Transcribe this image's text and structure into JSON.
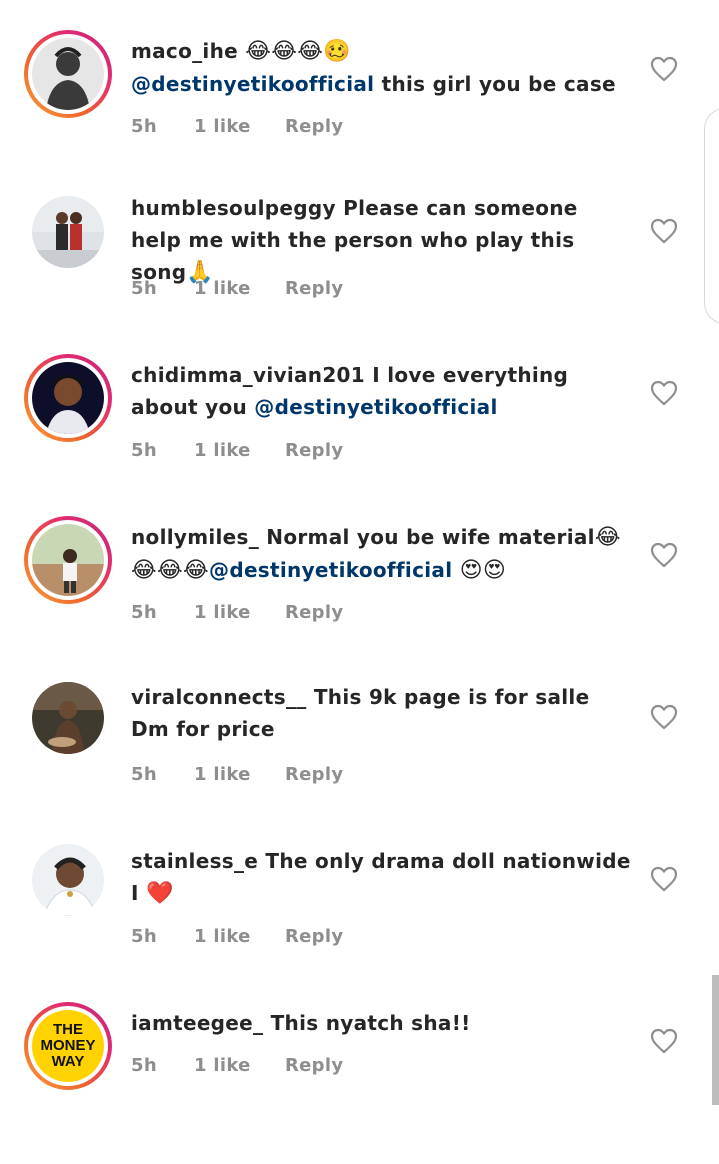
{
  "comments": [
    {
      "username": "maco_ihe",
      "parts": [
        {
          "t": " "
        },
        {
          "e": "😂😂😂🥴"
        },
        {
          "br": true
        },
        {
          "m": "@destinyetikoofficial"
        },
        {
          "t": " this girl you be case"
        }
      ],
      "time": "5h",
      "likes": "1 like",
      "reply": "Reply",
      "avatar": "silhouette-avatar",
      "story_ring": true
    },
    {
      "username": "humblesoulpeggy",
      "parts": [
        {
          "t": " Please can someone help me with the person who play this song"
        },
        {
          "e": "🙏"
        }
      ],
      "time": "5h",
      "likes": "1 like",
      "reply": "Reply",
      "avatar": "couple-photo-avatar",
      "story_ring": false
    },
    {
      "username": "chidimma_vivian201",
      "parts": [
        {
          "t": " I love everything about you "
        },
        {
          "m": "@destinyetikoofficial"
        }
      ],
      "time": "5h",
      "likes": "1 like",
      "reply": "Reply",
      "avatar": "woman-portrait-avatar",
      "story_ring": true
    },
    {
      "username": "nollymiles_",
      "parts": [
        {
          "t": " Normal you be wife material"
        },
        {
          "e": "😂😂😂😂"
        },
        {
          "m": "@destinyetikoofficial"
        },
        {
          "t": " "
        },
        {
          "e": "😍😍"
        }
      ],
      "time": "5h",
      "likes": "1 like",
      "reply": "Reply",
      "avatar": "man-outdoor-avatar",
      "story_ring": true
    },
    {
      "username": "viralconnects__",
      "parts": [
        {
          "t": " This 9k page is for salle Dm for price"
        }
      ],
      "time": "5h",
      "likes": "1 like",
      "reply": "Reply",
      "avatar": "group-photo-avatar",
      "story_ring": false
    },
    {
      "username": "stainless_e",
      "parts": [
        {
          "t": " The only drama doll nationwide I "
        },
        {
          "e": "❤️"
        }
      ],
      "time": "5h",
      "likes": "1 like",
      "reply": "Reply",
      "avatar": "man-selfie-avatar",
      "story_ring": false
    },
    {
      "username": "iamteegee_",
      "parts": [
        {
          "t": " This nyatch sha!!"
        }
      ],
      "time": "5h",
      "likes": "1 like",
      "reply": "Reply",
      "avatar": "the-money-way-logo-avatar",
      "story_ring": true,
      "logo_text": [
        "THE",
        "MONEY",
        "WAY"
      ]
    }
  ],
  "colors": {
    "mention": "#00376b",
    "meta": "#8e8e8e",
    "text": "#262626"
  },
  "icons": {
    "like": "heart-outline-icon"
  }
}
